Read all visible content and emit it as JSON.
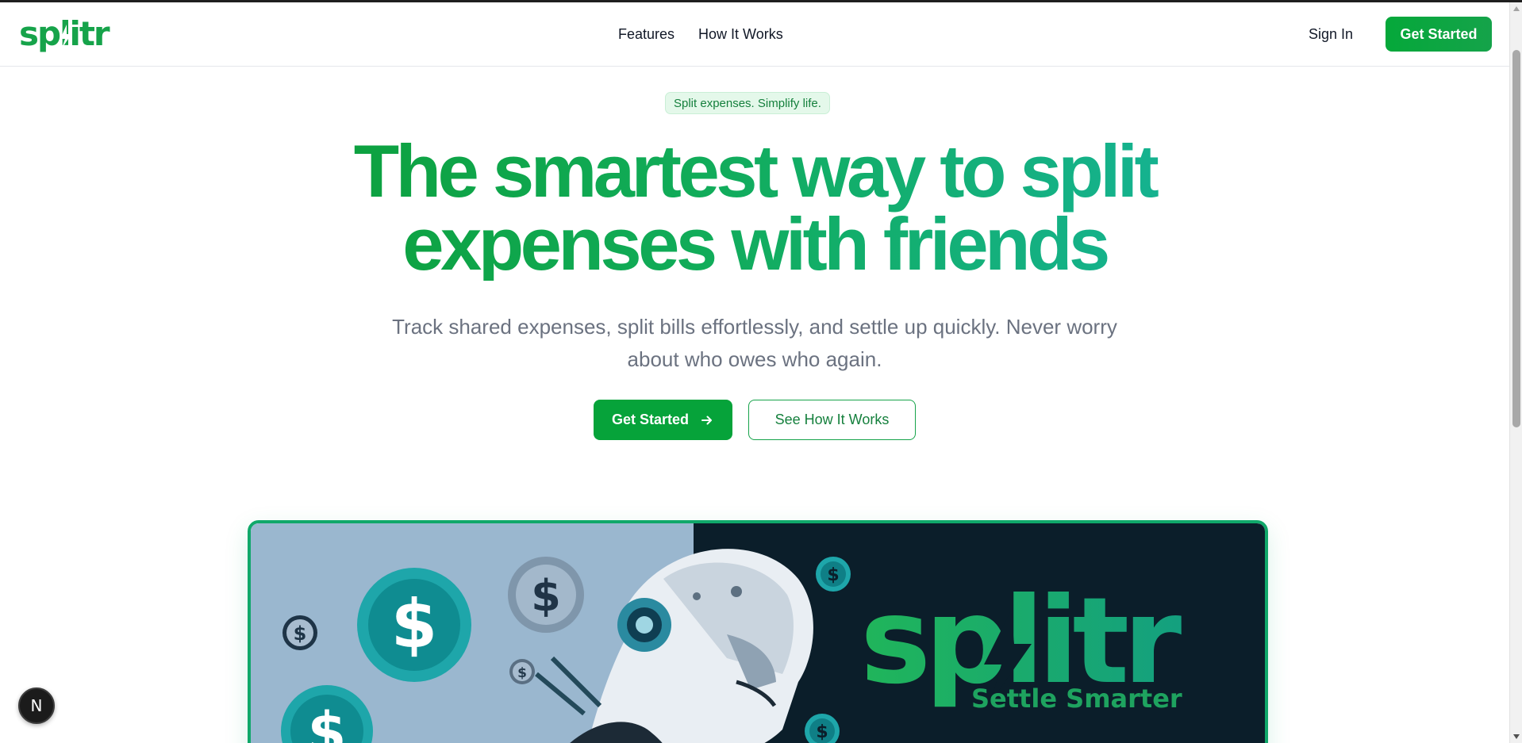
{
  "brand": {
    "logo_text": "splitr",
    "accent_color": "#16a34a",
    "teal_color": "#14b8a6"
  },
  "nav": {
    "links": [
      "Features",
      "How It Works"
    ],
    "sign_in": "Sign In",
    "cta": "Get Started"
  },
  "hero": {
    "badge": "Split expenses. Simplify life.",
    "title_line1": "The smartest way to split",
    "title_line2": "expenses with friends",
    "subtitle": "Track shared expenses, split bills effortlessly, and settle up quickly. Never worry about who owes who again.",
    "primary_button": "Get Started",
    "primary_button_icon": "arrow-right-icon",
    "secondary_button": "See How It Works"
  },
  "preview": {
    "brand_text": "splitr",
    "tagline": "Settle Smarter",
    "coin_symbol": "$"
  },
  "dev_indicator": {
    "label": "N"
  }
}
